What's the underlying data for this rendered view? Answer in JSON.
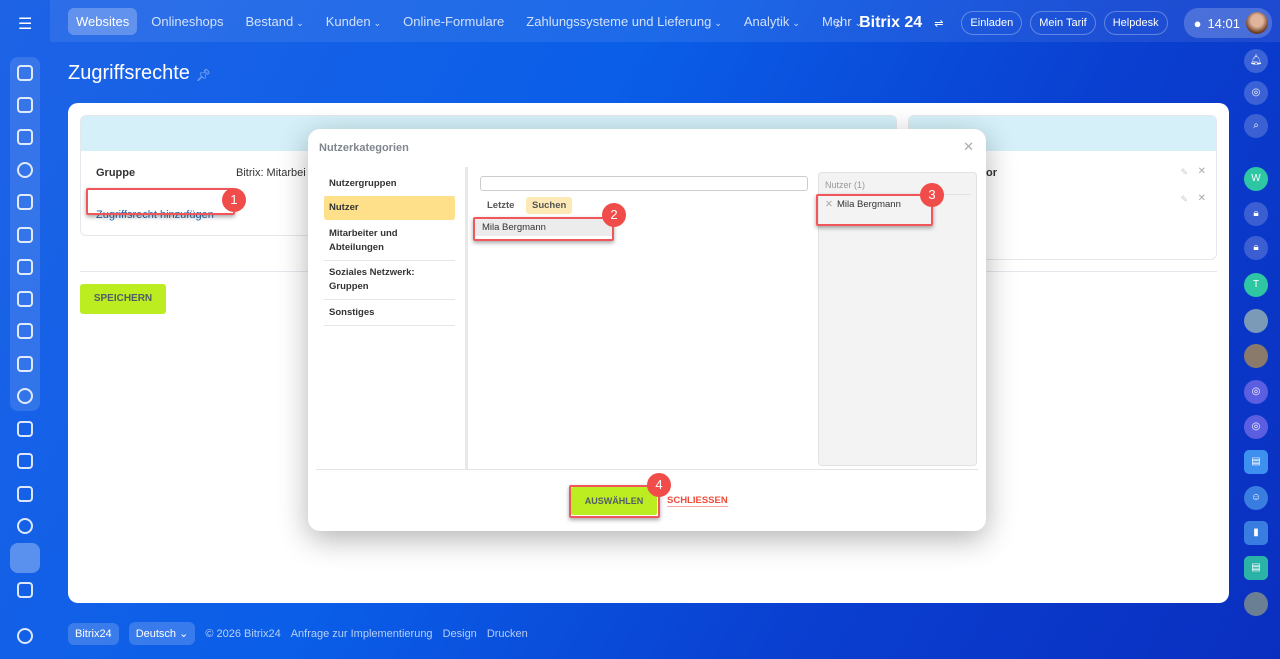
{
  "topnav": {
    "items": [
      {
        "label": "Websites",
        "active": true
      },
      {
        "label": "Onlineshops"
      },
      {
        "label": "Bestand",
        "dropdown": true
      },
      {
        "label": "Kunden",
        "dropdown": true
      },
      {
        "label": "Online-Formulare"
      },
      {
        "label": "Zahlungssysteme und Lieferung",
        "dropdown": true
      },
      {
        "label": "Analytik",
        "dropdown": true
      },
      {
        "label": "Mehr",
        "dropdown": true
      }
    ],
    "brand": "Bitrix 24",
    "invite": "Einladen",
    "tariff": "Mein Tarif",
    "helpdesk": "Helpdesk",
    "time": "14:01"
  },
  "page": {
    "title": "Zugriffsrechte"
  },
  "main": {
    "group_label": "Gruppe",
    "group_value": "Bitrix: Mitarbei",
    "add_link": "Zugriffsrecht hinzufügen",
    "right_label_tail": "or",
    "save": "SPEICHERN"
  },
  "right_sidebar": {
    "w_label": "W",
    "t_label": "T"
  },
  "dialog": {
    "title": "Nutzerkategorien",
    "categories": [
      "Nutzergruppen",
      "Nutzer",
      "Mitarbeiter und Abteilungen",
      "Soziales Netzwerk: Gruppen",
      "Sonstiges"
    ],
    "selected_category": "Nutzer",
    "search_value": "",
    "tabs": [
      "Letzte",
      "Suchen"
    ],
    "active_tab": "Suchen",
    "result": "Mila Bergmann",
    "selected_header": "Nutzer (1)",
    "selected_item": "Mila Bergmann",
    "select_button": "AUSWÄHLEN",
    "close_button": "SCHLIESSEN"
  },
  "annotations": [
    "1",
    "2",
    "3",
    "4"
  ],
  "footer": {
    "brand": "Bitrix24",
    "language": "Deutsch",
    "copyright": "© 2026 Bitrix24",
    "links": [
      "Anfrage zur Implementierung",
      "Design",
      "Drucken"
    ]
  },
  "colors": {
    "accent": "#bbed21",
    "highlight": "#f04c4a",
    "link": "#2067b0"
  }
}
